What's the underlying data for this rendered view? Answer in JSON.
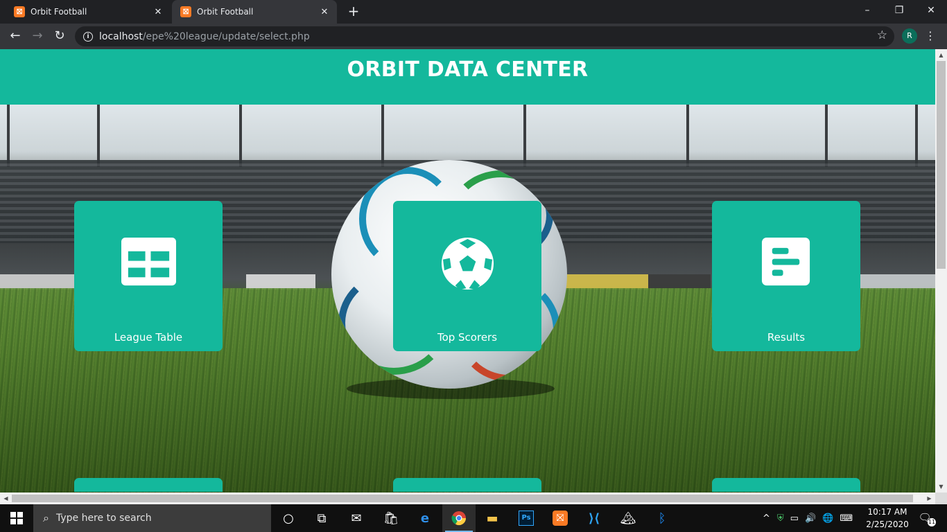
{
  "browser": {
    "tabs": [
      {
        "title": "Orbit Football",
        "favicon": "xampp-icon",
        "active": false
      },
      {
        "title": "Orbit Football",
        "favicon": "xampp-icon",
        "active": true
      }
    ],
    "new_tab": "+",
    "window_controls": {
      "minimize": "–",
      "restore": "❐",
      "close": "✕"
    },
    "url": {
      "host": "localhost",
      "path": "/epe%20league/update/select.php"
    },
    "profile_initial": "R",
    "menu": "⋮"
  },
  "page": {
    "title": "ORBIT DATA CENTER",
    "cards": [
      {
        "label": "League Table",
        "icon": "table-grid-icon"
      },
      {
        "label": "Top Scorers",
        "icon": "soccer-ball-icon"
      },
      {
        "label": "Results",
        "icon": "bar-list-icon"
      }
    ],
    "background": "stadium-football-photo",
    "accent_color": "#14b89c"
  },
  "taskbar": {
    "search_placeholder": "Type here to search",
    "pinned_icons": [
      "cortana-icon",
      "task-view-icon",
      "mail-icon",
      "store-icon",
      "edge-icon",
      "chrome-icon",
      "file-explorer-icon",
      "photoshop-icon",
      "xampp-icon",
      "vscode-icon",
      "photos-icon",
      "bluetooth-icon"
    ],
    "photoshop_label": "Ps",
    "time": "10:17 AM",
    "date": "2/25/2020",
    "notification_count": "11"
  }
}
